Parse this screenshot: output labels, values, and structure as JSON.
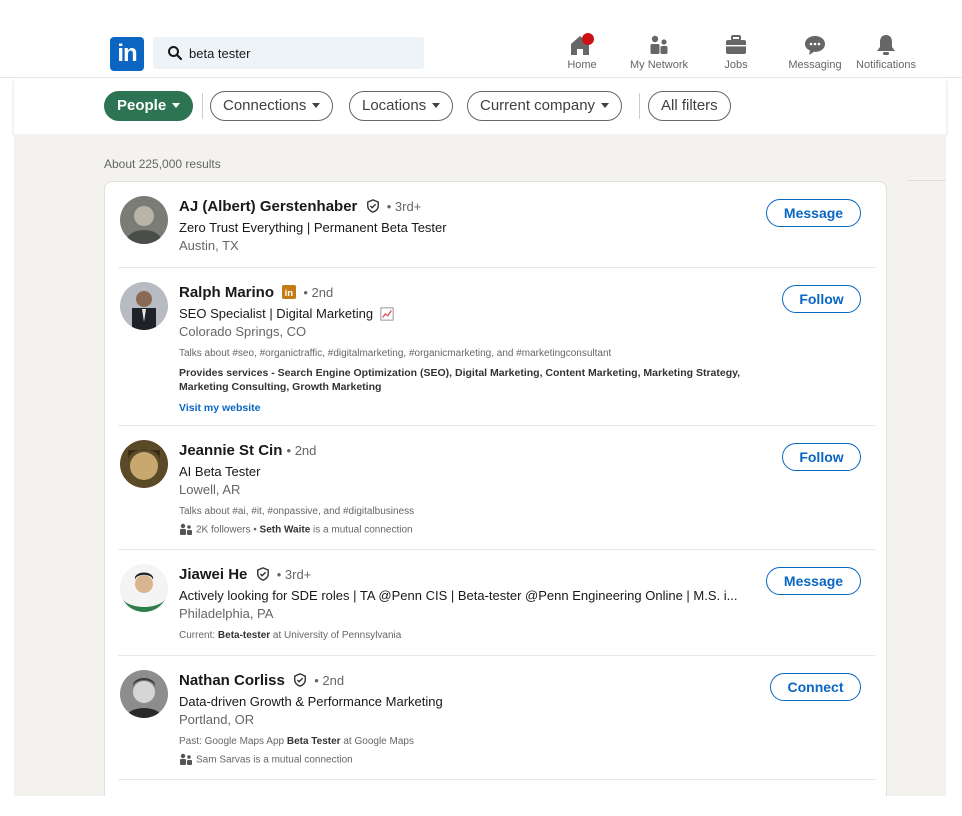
{
  "nav": {
    "search_value": "beta tester",
    "items": [
      {
        "label": "Home",
        "icon": "home-icon"
      },
      {
        "label": "My Network",
        "icon": "network-icon"
      },
      {
        "label": "Jobs",
        "icon": "briefcase-icon"
      },
      {
        "label": "Messaging",
        "icon": "messaging-icon"
      },
      {
        "label": "Notifications",
        "icon": "bell-icon"
      }
    ],
    "logo_text": "in"
  },
  "filters": {
    "people": "People",
    "connections": "Connections",
    "locations": "Locations",
    "current_company": "Current company",
    "all_filters": "All filters"
  },
  "results_count": "About 225,000 results",
  "results": [
    {
      "name": "AJ (Albert) Gerstenhaber",
      "degree": "• 3rd+",
      "headline": "Zero Trust Everything | Permanent Beta Tester",
      "location": "Austin, TX",
      "action": "Message"
    },
    {
      "name": "Ralph Marino",
      "degree": "• 2nd",
      "headline": "SEO Specialist | Digital Marketing",
      "location": "Colorado Springs, CO",
      "talks_about": "Talks about #seo, #organictraffic, #digitalmarketing, #organicmarketing, and #marketingconsultant",
      "services": "Provides services - Search Engine Optimization (SEO), Digital Marketing, Content Marketing, Marketing Strategy, Marketing Consulting, Growth Marketing",
      "link": "Visit my website",
      "action": "Follow"
    },
    {
      "name": "Jeannie St Cin",
      "degree": "• 2nd",
      "headline": "AI Beta Tester",
      "location": "Lowell, AR",
      "talks_about": "Talks about #ai, #it, #onpassive, and #digitalbusiness",
      "followers": "2K followers • ",
      "mutual_name": "Seth Waite",
      "mutual_suffix": " is a mutual connection",
      "action": "Follow"
    },
    {
      "name": "Jiawei He",
      "degree": "• 3rd+",
      "headline": "Actively looking for SDE roles | TA @Penn CIS | Beta-tester @Penn Engineering Online | M.S. i...",
      "location": "Philadelphia, PA",
      "current_prefix": "Current: ",
      "current_role": "Beta-tester",
      "current_suffix": " at University of Pennsylvania",
      "action": "Message"
    },
    {
      "name": "Nathan Corliss",
      "degree": "• 2nd",
      "headline": "Data-driven Growth & Performance Marketing",
      "location": "Portland, OR",
      "past_prefix": "Past: Google Maps App ",
      "past_role": "Beta Tester",
      "past_suffix": " at Google Maps",
      "mutual_name": "Sam Sarvas is a mutual connection",
      "action": "Connect"
    }
  ],
  "colors": {
    "brand": "#0a66c2",
    "active_filter": "#2d7552",
    "notification_dot": "#cc1016"
  }
}
